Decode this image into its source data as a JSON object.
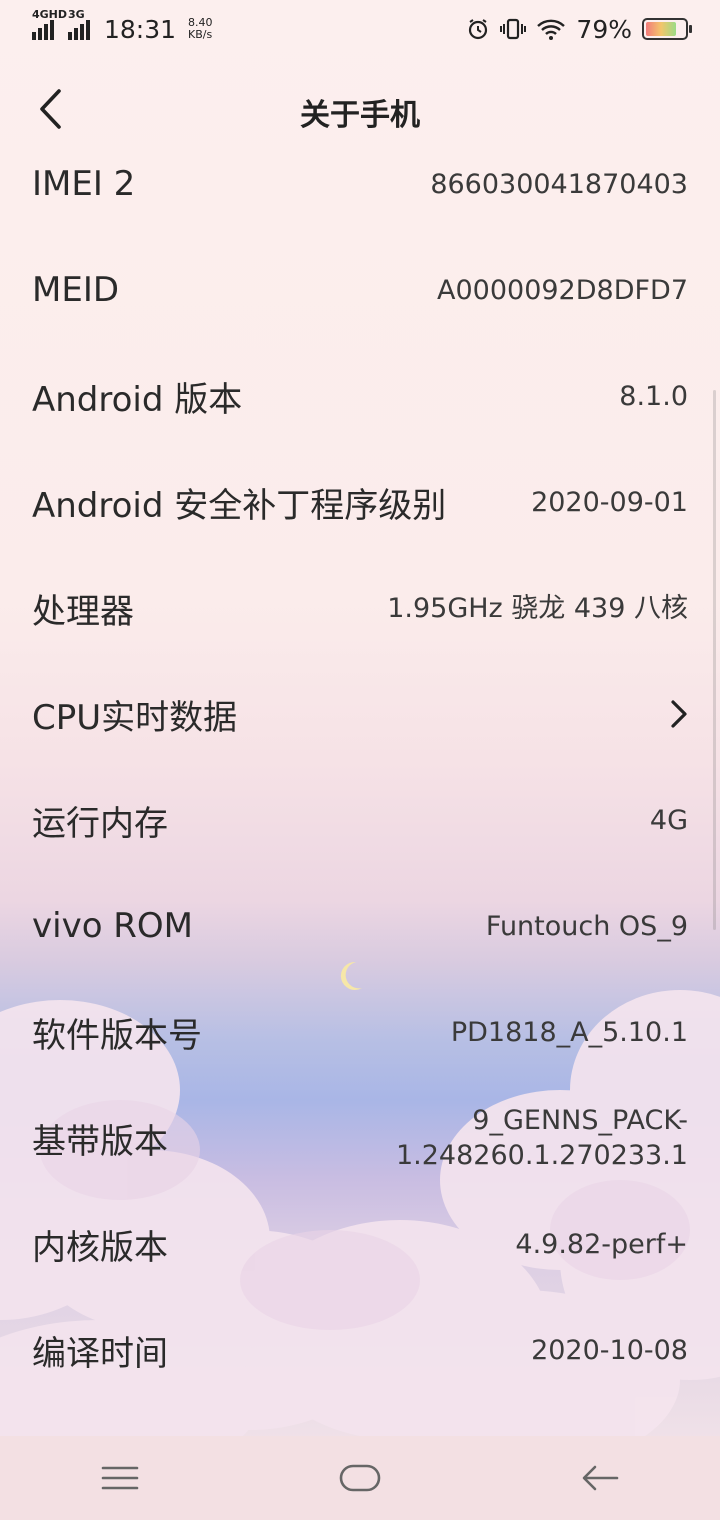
{
  "status_bar": {
    "net1": "4GHD",
    "net2": "3G",
    "time": "18:31",
    "speed_value": "8.40",
    "speed_unit": "KB/s",
    "battery": "79%",
    "battery_level": 0.79,
    "icons": [
      "alarm-icon",
      "vibrate-icon",
      "wifi-icon",
      "battery-icon"
    ]
  },
  "header": {
    "title": "关于手机",
    "back_icon": "chevron-left-icon"
  },
  "rows": [
    {
      "label": "IMEI 2",
      "value": "866030041870403"
    },
    {
      "label": "MEID",
      "value": "A0000092D8DFD7"
    },
    {
      "label": "Android 版本",
      "value": "8.1.0"
    },
    {
      "label": "Android 安全补丁程序级别",
      "value": "2020-09-01"
    },
    {
      "label": "处理器",
      "value": "1.95GHz 骁龙 439 八核"
    },
    {
      "label": "CPU实时数据",
      "value": ""
    },
    {
      "label": "运行内存",
      "value": "4G"
    },
    {
      "label": "vivo ROM",
      "value": "Funtouch OS_9"
    },
    {
      "label": "软件版本号",
      "value": "PD1818_A_5.10.1"
    },
    {
      "label": "基带版本",
      "value_line1": "9_GENNS_PACK-",
      "value_line2": "1.248260.1.270233.1"
    },
    {
      "label": "内核版本",
      "value": "4.9.82-perf+"
    },
    {
      "label": "编译时间",
      "value": "2020-10-08"
    }
  ],
  "nav_bar": {
    "icons": [
      "menu-icon",
      "home-icon",
      "back-arrow-icon"
    ]
  },
  "colors": {
    "background_top": "#fcefee",
    "sky_blue": "#a9b6e6",
    "nav_bg": "#f3e0e3"
  }
}
